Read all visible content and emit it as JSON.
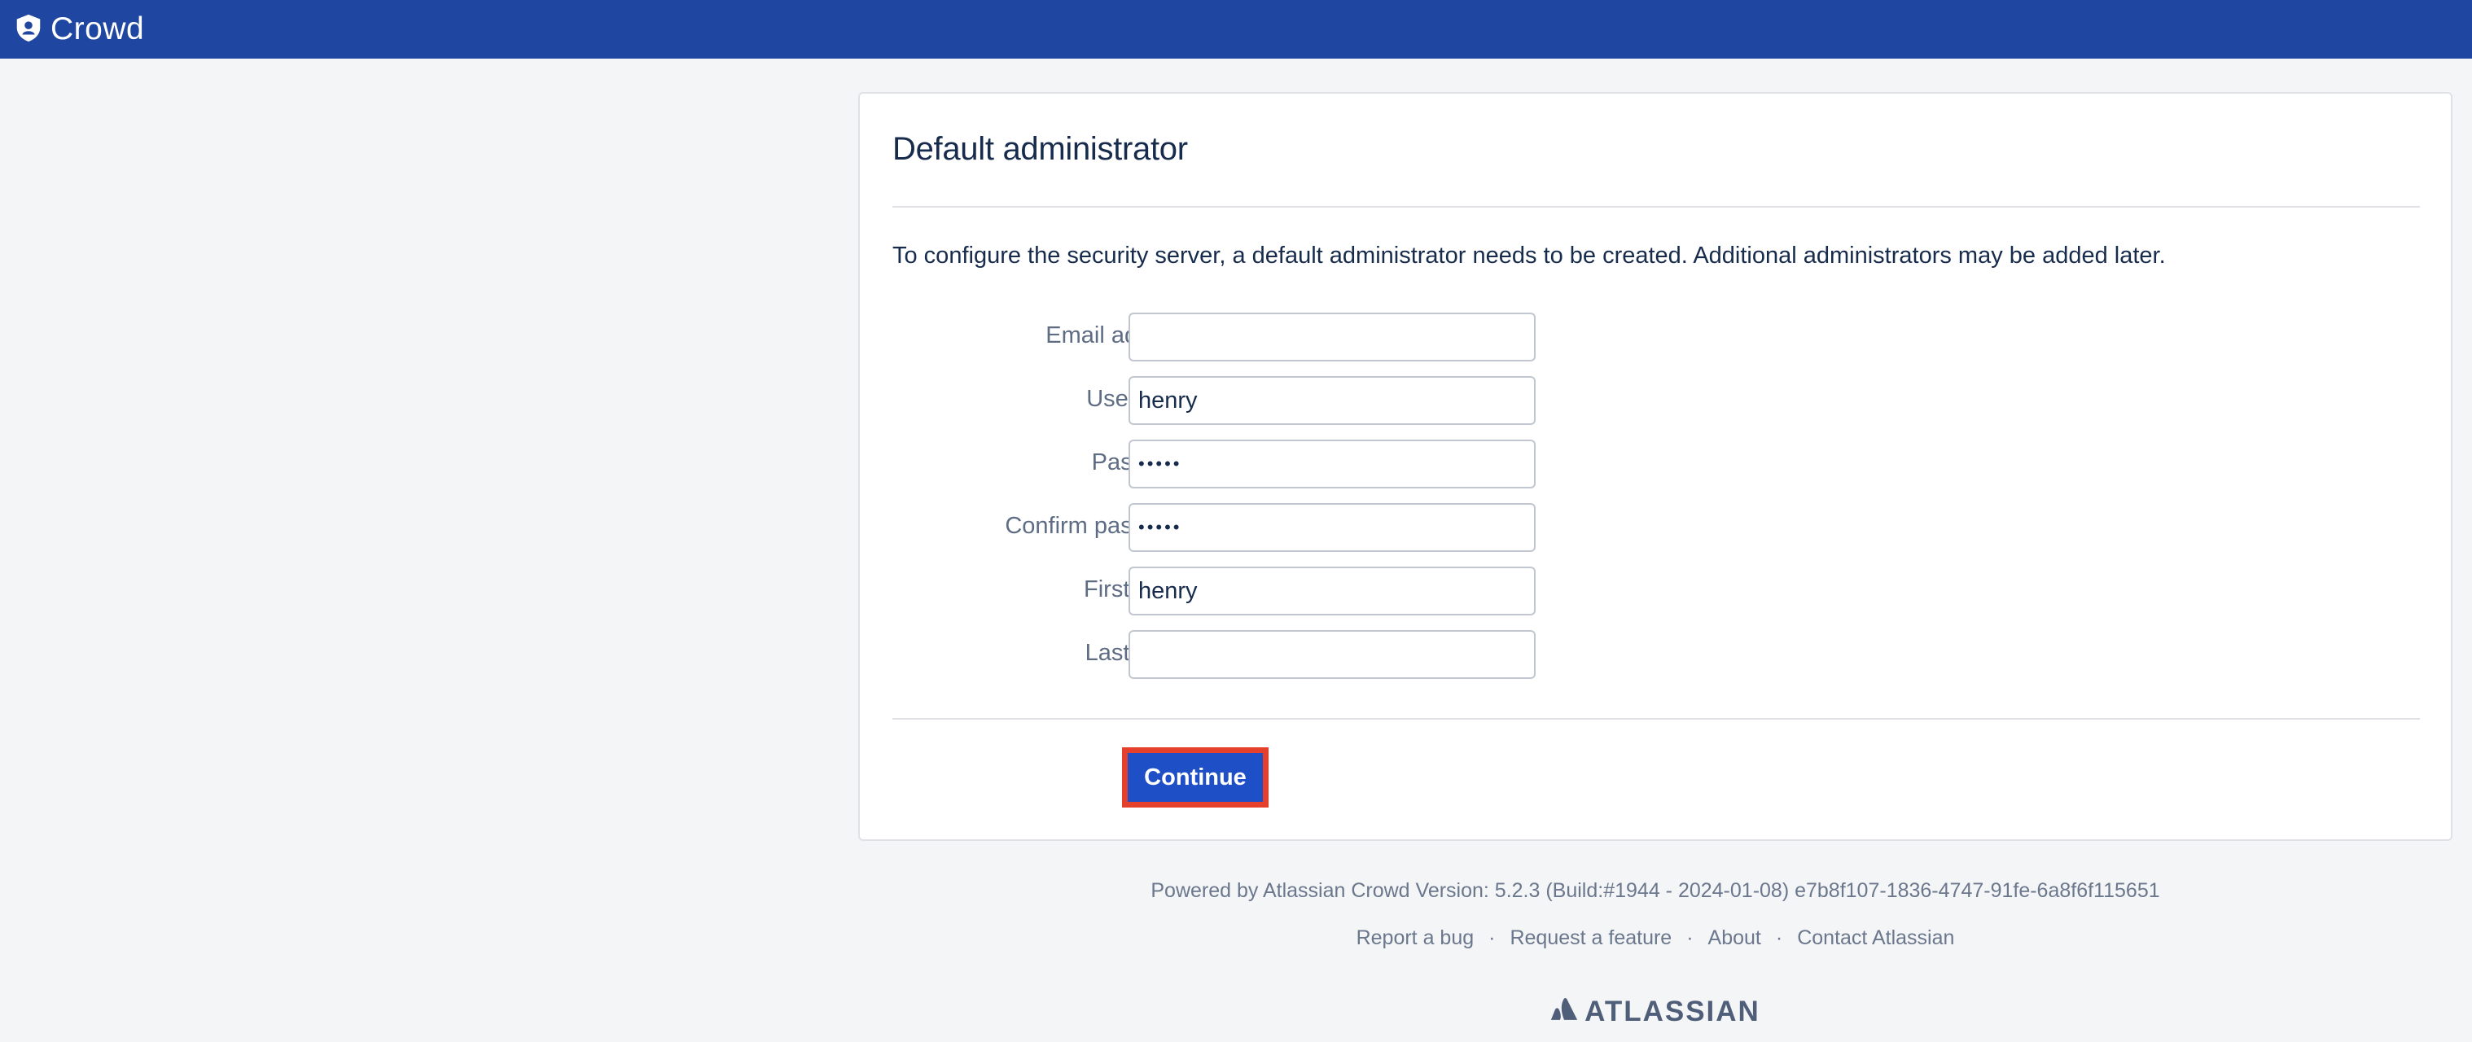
{
  "header": {
    "app_name": "Crowd",
    "logo_icon": "crowd-logo-icon",
    "background_color": "#1f47a1"
  },
  "form": {
    "title": "Default administrator",
    "intro": "To configure the security server, a default administrator needs to be created. Additional administrators may be added later.",
    "required_marker": "*",
    "fields": [
      {
        "label": "Email address",
        "value": "",
        "type": "text"
      },
      {
        "label": "Username",
        "value": "henry",
        "type": "text"
      },
      {
        "label": "Password",
        "value": "•••••",
        "type": "password"
      },
      {
        "label": "Confirm password",
        "value": "•••••",
        "type": "password"
      },
      {
        "label": "First name",
        "value": "henry",
        "type": "text"
      },
      {
        "label": "Last name",
        "value": "",
        "type": "text"
      }
    ],
    "continue_label": "Continue",
    "button_color": "#1e4fc7",
    "highlight_color": "#e5402b"
  },
  "footer": {
    "powered_by": "Powered by Atlassian Crowd Version: 5.2.3 (Build:#1944 - 2024-01-08) e7b8f107-1836-4747-91fe-6a8f6f115651",
    "links": [
      "Report a bug",
      "Request a feature",
      "About",
      "Contact Atlassian"
    ],
    "separator": "·",
    "brand": "ATLASSIAN",
    "brand_icon": "atlassian-logo-icon"
  }
}
